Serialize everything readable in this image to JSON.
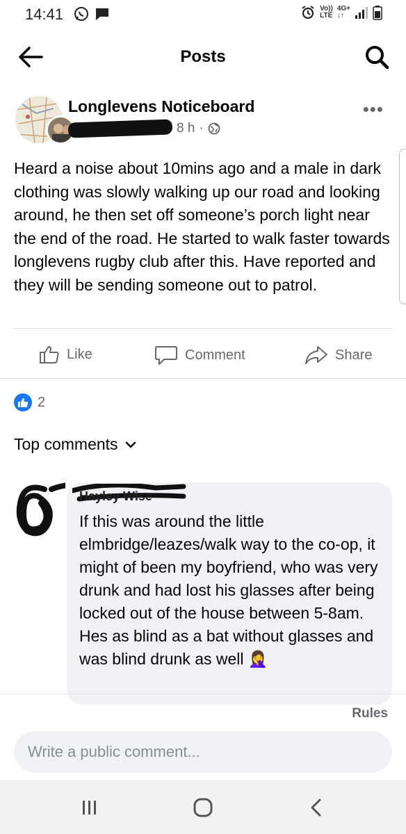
{
  "status_bar": {
    "time": "14:41",
    "network_top": "Vo))",
    "network_bottom": "LTE",
    "data_top": "4G+",
    "data_bottom": "↓↑"
  },
  "header": {
    "title": "Posts",
    "back_icon": "arrow-left-icon",
    "search_icon": "search-icon"
  },
  "post": {
    "group_name": "Longlevens Noticeboard",
    "time_ago": "8 h",
    "separator": "·",
    "visibility_icon": "globe-icon",
    "more_label": "•••",
    "text": "Heard a noise about 10mins ago and a male in dark clothing was slowly walking up our road and looking around, he then set off someone’s porch light near the end of the road. He started to walk faster towards longlevens rugby club after this. Have reported and they will be sending someone out to patrol."
  },
  "actions": {
    "like": "Like",
    "comment": "Comment",
    "share": "Share"
  },
  "reactions": {
    "count": "2"
  },
  "comments": {
    "section_label": "Top comments",
    "items": [
      {
        "author": "Hayley Wise",
        "text": "If this was around the little elmbridge/leazes/walk way to the co-op, it might of been my boyfriend, who was very drunk and had lost his glasses after being locked out of the house between 5-8am. Hes as blind as a bat without glasses and was blind drunk as well",
        "emoji": "🤦‍♀️"
      }
    ]
  },
  "footer": {
    "rules": "Rules",
    "composer_placeholder": "Write a public comment..."
  },
  "colors": {
    "facebook_blue": "#1877f2",
    "secondary_text": "#65676b",
    "bubble_bg": "#f0f2f5"
  }
}
